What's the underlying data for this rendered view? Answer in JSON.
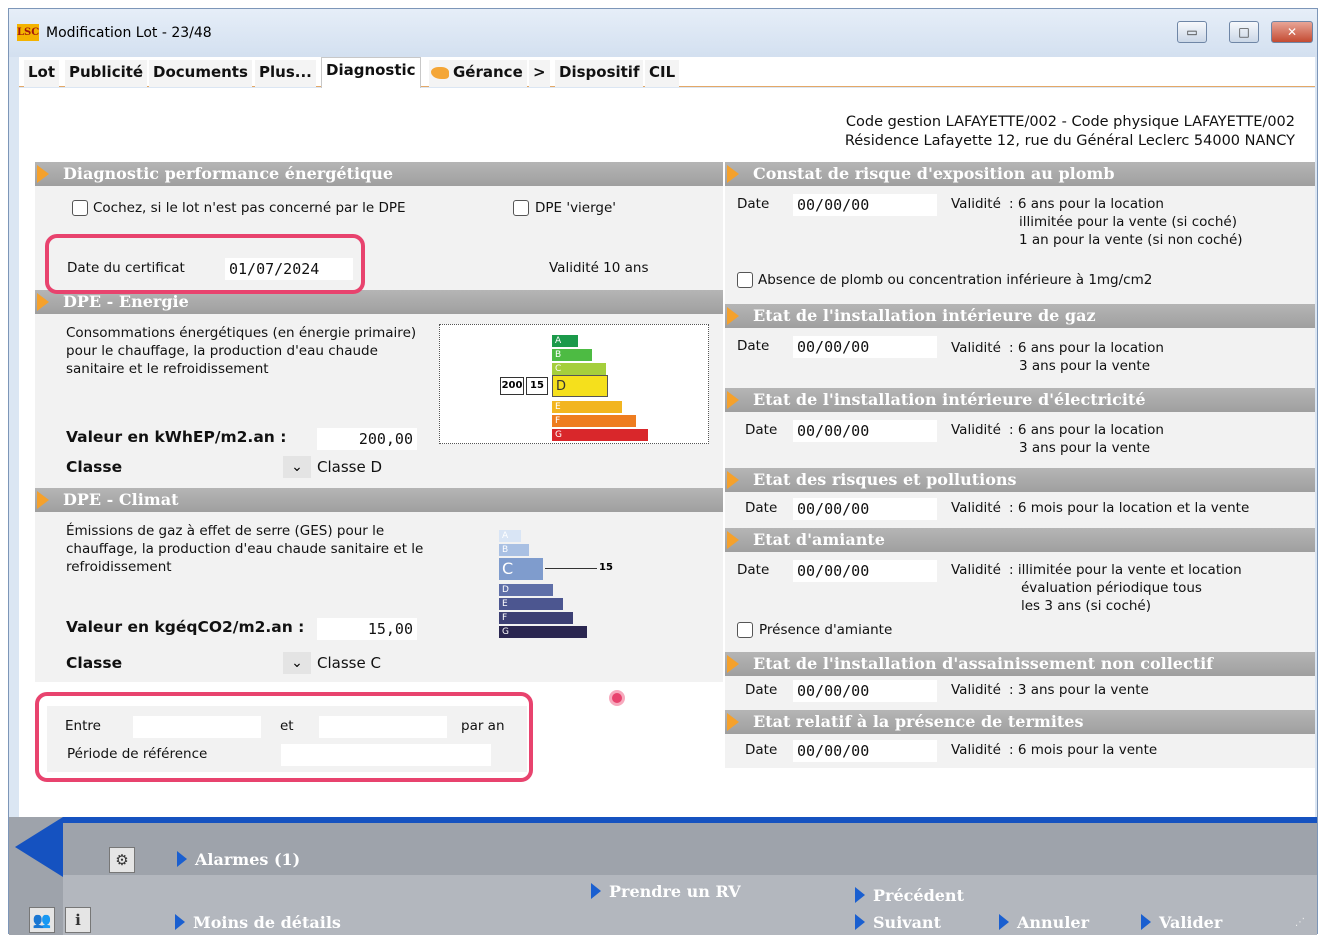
{
  "window": {
    "title": "Modification Lot - 23/48",
    "logo": "LSC",
    "minimize": "▭",
    "maximize": "□",
    "close": "✕"
  },
  "tabs": [
    {
      "label": "Lot"
    },
    {
      "label": "Publicité"
    },
    {
      "label": "Documents"
    },
    {
      "label": "Plus..."
    },
    {
      "label": "Diagnostic",
      "active": true
    },
    {
      "label": "Gérance"
    },
    {
      "label": ">"
    },
    {
      "label": "Dispositif"
    },
    {
      "label": "CIL"
    }
  ],
  "header": {
    "line1": "Code gestion LAFAYETTE/002 - Code physique LAFAYETTE/002",
    "line2": "Résidence Lafayette 12, rue du Général Leclerc 54000 NANCY"
  },
  "dpe": {
    "title": "Diagnostic performance énergétique",
    "not_concerned": "Cochez, si le lot n'est pas concerné par le DPE",
    "vierge": "DPE 'vierge'",
    "cert_label": "Date du certificat",
    "cert_date": "01/07/2024",
    "validity": "Validité 10 ans"
  },
  "energie": {
    "title": "DPE - Energie",
    "description": "Consommations énergétiques (en énergie primaire) pour le chauffage, la production d'eau chaude sanitaire et le refroidissement",
    "value_label": "Valeur en kWhEP/m2.an :",
    "value": "200,00",
    "class_label": "Classe",
    "class_value": "Classe D",
    "chart_val1": "200",
    "chart_val2": "15",
    "letters": [
      "A",
      "B",
      "C",
      "D",
      "E",
      "F",
      "G"
    ],
    "active_letter": "D"
  },
  "climat": {
    "title": "DPE - Climat",
    "description": "Émissions de gaz à effet de serre (GES) pour le chauffage, la production d'eau chaude sanitaire et le refroidissement",
    "value_label": "Valeur en kgéqCO2/m2.an :",
    "value": "15,00",
    "class_label": "Classe",
    "class_value": "Classe C",
    "chart_val": "15",
    "letters": [
      "A",
      "B",
      "C",
      "D",
      "E",
      "F",
      "G"
    ],
    "active_letter": "C"
  },
  "periode": {
    "entre": "Entre",
    "et": "et",
    "par_an": "par an",
    "reference": "Période de référence"
  },
  "right": {
    "plomb": {
      "title": "Constat de risque d'exposition au plomb",
      "date_label": "Date",
      "date": "00/00/00",
      "validite": "Validité",
      "v1": ": 6 ans  pour la location",
      "v2": "illimitée  pour la vente (si coché)",
      "v3": "1 an pour la vente (si non coché)",
      "absence": "Absence de plomb ou concentration inférieure à 1mg/cm2"
    },
    "gaz": {
      "title": "Etat de l'installation intérieure de gaz",
      "date_label": "Date",
      "date": "00/00/00",
      "validite": "Validité",
      "v1": ": 6 ans  pour la location",
      "v2": "3 ans  pour la vente"
    },
    "elec": {
      "title": "Etat de l'installation intérieure d'électricité",
      "date_label": "Date",
      "date": "00/00/00",
      "validite": "Validité",
      "v1": ": 6 ans  pour la location",
      "v2": "3 ans  pour la vente"
    },
    "risques": {
      "title": "Etat des risques et pollutions",
      "date_label": "Date",
      "date": "00/00/00",
      "validite": "Validité",
      "v1": ": 6 mois pour la location et la vente"
    },
    "amiante": {
      "title": "Etat d'amiante",
      "date_label": "Date",
      "date": "00/00/00",
      "validite": "Validité",
      "v1": ":  illimitée pour la vente et location",
      "v2": "évaluation périodique tous",
      "v3": "les 3 ans (si coché)",
      "presence": "Présence d'amiante"
    },
    "assain": {
      "title": "Etat de l'installation d'assainissement non collectif",
      "date_label": "Date",
      "date": "00/00/00",
      "validite": "Validité",
      "v1": ": 3 ans  pour la vente"
    },
    "termites": {
      "title": "Etat relatif à la présence de termites",
      "date_label": "Date",
      "date": "00/00/00",
      "validite": "Validité",
      "v1": ": 6 mois  pour la vente"
    }
  },
  "bottom": {
    "alarmes": "Alarmes (1)",
    "moins": "Moins de détails",
    "rv": "Prendre un RV",
    "precedent": "Précédent",
    "suivant": "Suivant",
    "annuler": "Annuler",
    "valider": "Valider"
  },
  "colors": {
    "accent": "#f5a12c",
    "highlight": "#e8436e",
    "link_arrow": "#1a5fd0"
  }
}
